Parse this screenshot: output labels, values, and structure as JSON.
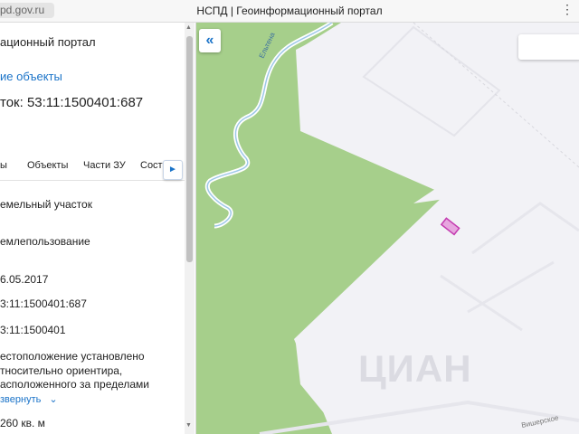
{
  "browser": {
    "url_fragment": "pd.gov.ru",
    "window_title": "НСПД | Геоинформационный портал",
    "menu_glyph": "⋮"
  },
  "panel": {
    "portal_label": "ационный портал",
    "objects_link": "ие объекты",
    "parcel_title": "ток: 53:11:1500401:687",
    "tabs": [
      "ы",
      "Объекты",
      "Части ЗУ",
      "Соста"
    ],
    "tab_next": "►",
    "fields": {
      "type": "емельный участок",
      "usage": "емлепользование",
      "date": "6.05.2017",
      "cad_number": "3:11:1500401:687",
      "quarter": "3:11:1500401",
      "location_line1": "естоположение установлено",
      "location_line2": "тносительно ориентира,",
      "location_line3": "асположенного за пределами"
    },
    "expand_label": "звернуть",
    "area": "260 кв. м"
  },
  "map": {
    "collapse_glyph": "«",
    "watermark": "ЦИАН",
    "river_label": "Ельтена",
    "road_label": "Вишерское",
    "colors": {
      "forest": "#a6cf8b",
      "field": "#f2f2f6",
      "river": "#ffffff",
      "parcel": "#c43bb0",
      "link": "#1a73c8"
    }
  }
}
